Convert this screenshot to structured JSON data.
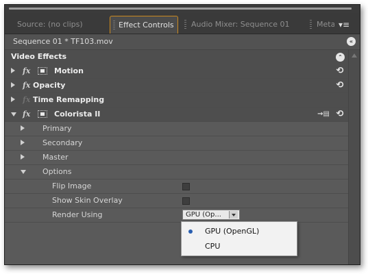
{
  "tabs": [
    {
      "label": "Source: (no clips)",
      "active": false
    },
    {
      "label": "Effect Controls",
      "active": true,
      "close": "×"
    },
    {
      "label": "Audio Mixer: Sequence 01",
      "active": false
    },
    {
      "label": "Meta",
      "active": false
    }
  ],
  "panel_menu": "▾≡",
  "sequence": {
    "title": "Sequence 01 * TF103.mov"
  },
  "video_effects": {
    "label": "Video Effects"
  },
  "effects": [
    {
      "label": "Motion",
      "fx": "fx",
      "expanded": false
    },
    {
      "label": "Opacity",
      "fx": "fx",
      "expanded": false
    },
    {
      "label": "Time Remapping",
      "fx": "fx",
      "expanded": false
    },
    {
      "label": "Colorista II",
      "fx": "fx",
      "expanded": true
    }
  ],
  "colorista_groups": [
    {
      "label": "Primary",
      "expanded": false
    },
    {
      "label": "Secondary",
      "expanded": false
    },
    {
      "label": "Master",
      "expanded": false
    },
    {
      "label": "Options",
      "expanded": true
    }
  ],
  "options": {
    "flip_image": {
      "label": "Flip Image",
      "checked": false
    },
    "show_skin_overlay": {
      "label": "Show Skin Overlay",
      "checked": false
    },
    "render_using": {
      "label": "Render Using",
      "value": "GPU (Op..."
    }
  },
  "render_menu": {
    "items": [
      {
        "label": "GPU (OpenGL)",
        "selected": true
      },
      {
        "label": "CPU",
        "selected": false
      }
    ]
  },
  "colors": {
    "accent": "#cc8a1f",
    "panel": "#5a5a5a",
    "radio": "#2a5fb0"
  }
}
